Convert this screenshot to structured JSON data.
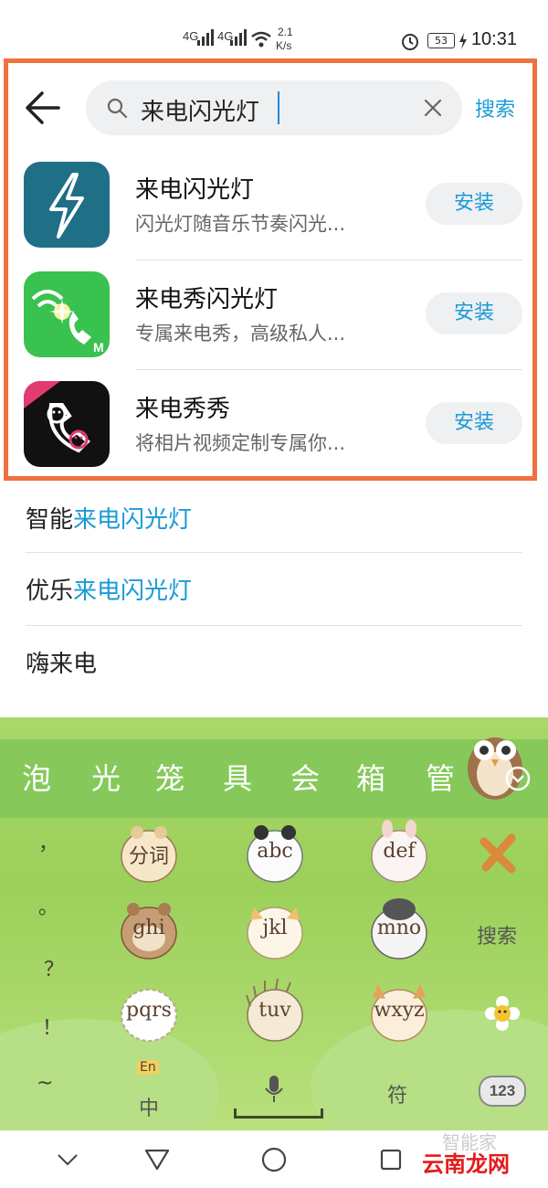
{
  "status_bar": {
    "signal1": "4G",
    "signal2": "4G",
    "speed_value": "2.1",
    "speed_unit": "K/s",
    "battery": "53",
    "time": "10:31"
  },
  "search": {
    "query": "来电闪光灯",
    "button_label": "搜索"
  },
  "apps": [
    {
      "name": "来电闪光灯",
      "desc": "闪光灯随音乐节奏闪光...",
      "action": "安装",
      "icon": "lightning-bolt-icon",
      "color": "#1f6f86"
    },
    {
      "name": "来电秀闪光灯",
      "desc": "专属来电秀，高级私人...",
      "action": "安装",
      "icon": "phone-flash-icon",
      "color": "#39c24f"
    },
    {
      "name": "来电秀秀",
      "desc": "将相片视频定制专属你...",
      "action": "安装",
      "icon": "phone-face-icon",
      "color": "#111111"
    }
  ],
  "suggestions": [
    {
      "prefix": "智能",
      "highlight": "来电闪光灯"
    },
    {
      "prefix": "优乐",
      "highlight": "来电闪光灯"
    },
    {
      "prefix": "嗨来电",
      "highlight": ""
    }
  ],
  "keyboard": {
    "candidates": [
      "泡",
      "光",
      "笼",
      "具",
      "会",
      "箱",
      "管"
    ],
    "punctuation": [
      "，",
      "。",
      "？",
      "！",
      "~"
    ],
    "keys": [
      "分词",
      "abc",
      "def",
      "ghi",
      "jkl",
      "mno",
      "pqrs",
      "tuv",
      "wxyz"
    ],
    "search_label": "搜索",
    "lang_badge": "En",
    "lang_label": "中",
    "symbol_label": "符",
    "numbers_label": "123"
  },
  "watermark": {
    "text1": "智能家",
    "text2": "云南龙网"
  },
  "colors": {
    "accent": "#1a9ad6",
    "highlight_border": "#f07040",
    "keyboard_green": "#9bd05a"
  }
}
